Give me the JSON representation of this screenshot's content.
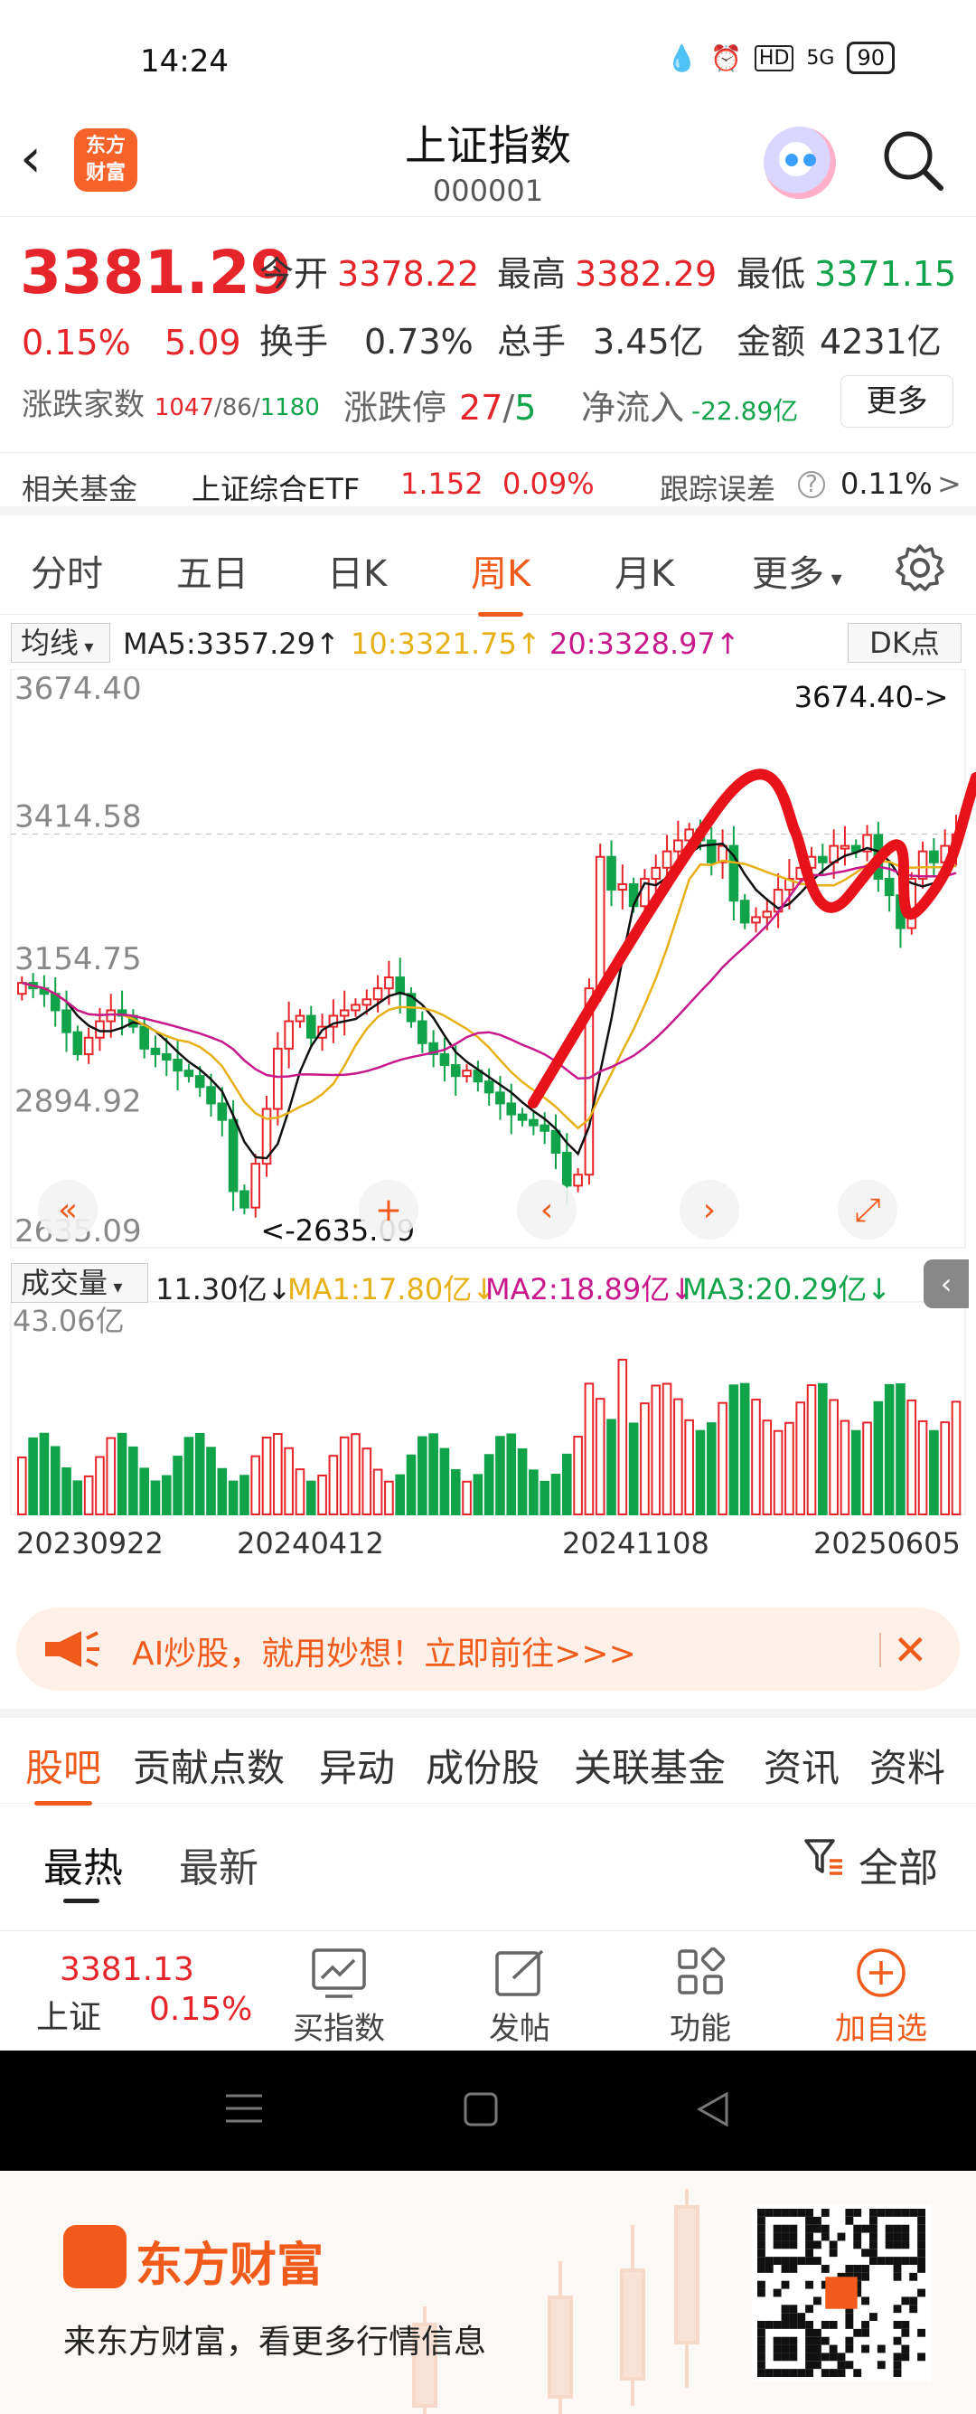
{
  "status": {
    "time": "14:24",
    "battery": "90",
    "net": "5G"
  },
  "header": {
    "title": "上证指数",
    "code": "000001",
    "logo_text": "东方财富"
  },
  "quote": {
    "price": "3381.29",
    "change_pct": "0.15%",
    "change_val": "5.09",
    "open_label": "今开",
    "open": "3378.22",
    "high_label": "最高",
    "high": "3382.29",
    "low_label": "最低",
    "low": "3371.15",
    "turnover_label": "换手",
    "turnover": "0.73%",
    "volume_label": "总手",
    "volume": "3.45亿",
    "amount_label": "金额",
    "amount": "4231亿",
    "updown_label": "涨跌家数",
    "up": "1047",
    "flat": "86",
    "down": "1180",
    "limit_label": "涨跌停",
    "limit_up": "27",
    "limit_down": "5",
    "netin_label": "净流入",
    "netin": "-22.89亿",
    "more": "更多"
  },
  "fund": {
    "label": "相关基金",
    "name": "上证综合ETF",
    "price": "1.152",
    "pct": "0.09%",
    "track_label": "跟踪误差",
    "track": "0.11%"
  },
  "tabs": [
    "分时",
    "五日",
    "日K",
    "周K",
    "月K",
    "更多"
  ],
  "active_tab": "周K",
  "ma": {
    "selector": "均线",
    "ma5": "MA5:3357.29",
    "ma10": "10:3321.75",
    "ma20": "20:3328.97",
    "dk": "DK点"
  },
  "vol_legend": {
    "selector": "成交量",
    "vol": "11.30亿",
    "ma1": "MA1:17.80亿",
    "ma2": "MA2:18.89亿",
    "ma3": "MA3:20.29亿",
    "max": "43.06亿"
  },
  "chart_data": {
    "type": "candlestick",
    "y_ticks": [
      "3674.40",
      "3414.58",
      "3154.75",
      "2894.92",
      "2635.09"
    ],
    "ylim": [
      2635.09,
      3674.4
    ],
    "high_annotation": "3674.40->",
    "low_annotation": "<-2635.09",
    "x_ticks": [
      "20230922",
      "20240412",
      "20241108",
      "20250605"
    ],
    "close": [
      3110,
      3100,
      3090,
      3060,
      3020,
      2980,
      3010,
      3040,
      3060,
      3050,
      3030,
      2990,
      2980,
      2970,
      2950,
      2940,
      2920,
      2890,
      2860,
      2730,
      2700,
      2780,
      2880,
      2990,
      3040,
      3050,
      3010,
      3030,
      3050,
      3060,
      3070,
      3080,
      3100,
      3120,
      3090,
      3040,
      3000,
      2980,
      2960,
      2940,
      2950,
      2930,
      2910,
      2890,
      2870,
      2860,
      2850,
      2840,
      2800,
      2740,
      2760,
      3100,
      3340,
      3280,
      3290,
      3250,
      3300,
      3320,
      3350,
      3370,
      3390,
      3370,
      3330,
      3360,
      3260,
      3220,
      3230,
      3240,
      3280,
      3300,
      3320,
      3340,
      3330,
      3360,
      3360,
      3350,
      3380,
      3300,
      3270,
      3210,
      3300,
      3350,
      3330,
      3360,
      3381
    ],
    "ma_lines": [
      "MA5",
      "MA10",
      "MA20"
    ],
    "volume_max": 43.06,
    "volume_unit": "亿"
  },
  "banner": {
    "text": "AI炒股，就用妙想！立即前往>>>"
  },
  "subtabs": [
    "股吧",
    "贡献点数",
    "异动",
    "成份股",
    "关联基金",
    "资讯",
    "资料"
  ],
  "sort": {
    "hot": "最热",
    "new": "最新",
    "filter": "全部"
  },
  "bottombar": {
    "price": "3381.13",
    "name": "上证",
    "pct": "0.15%",
    "buy": "买指数",
    "post": "发帖",
    "func": "功能",
    "add": "加自选"
  },
  "footer": {
    "brand": "东方财富",
    "slogan": "来东方财富，看更多行情信息"
  },
  "colors": {
    "up": "#e5252a",
    "down": "#10a34a",
    "accent": "#f05a1a",
    "ma5": "#111111",
    "ma10": "#e8b017",
    "ma20": "#c8198c"
  }
}
